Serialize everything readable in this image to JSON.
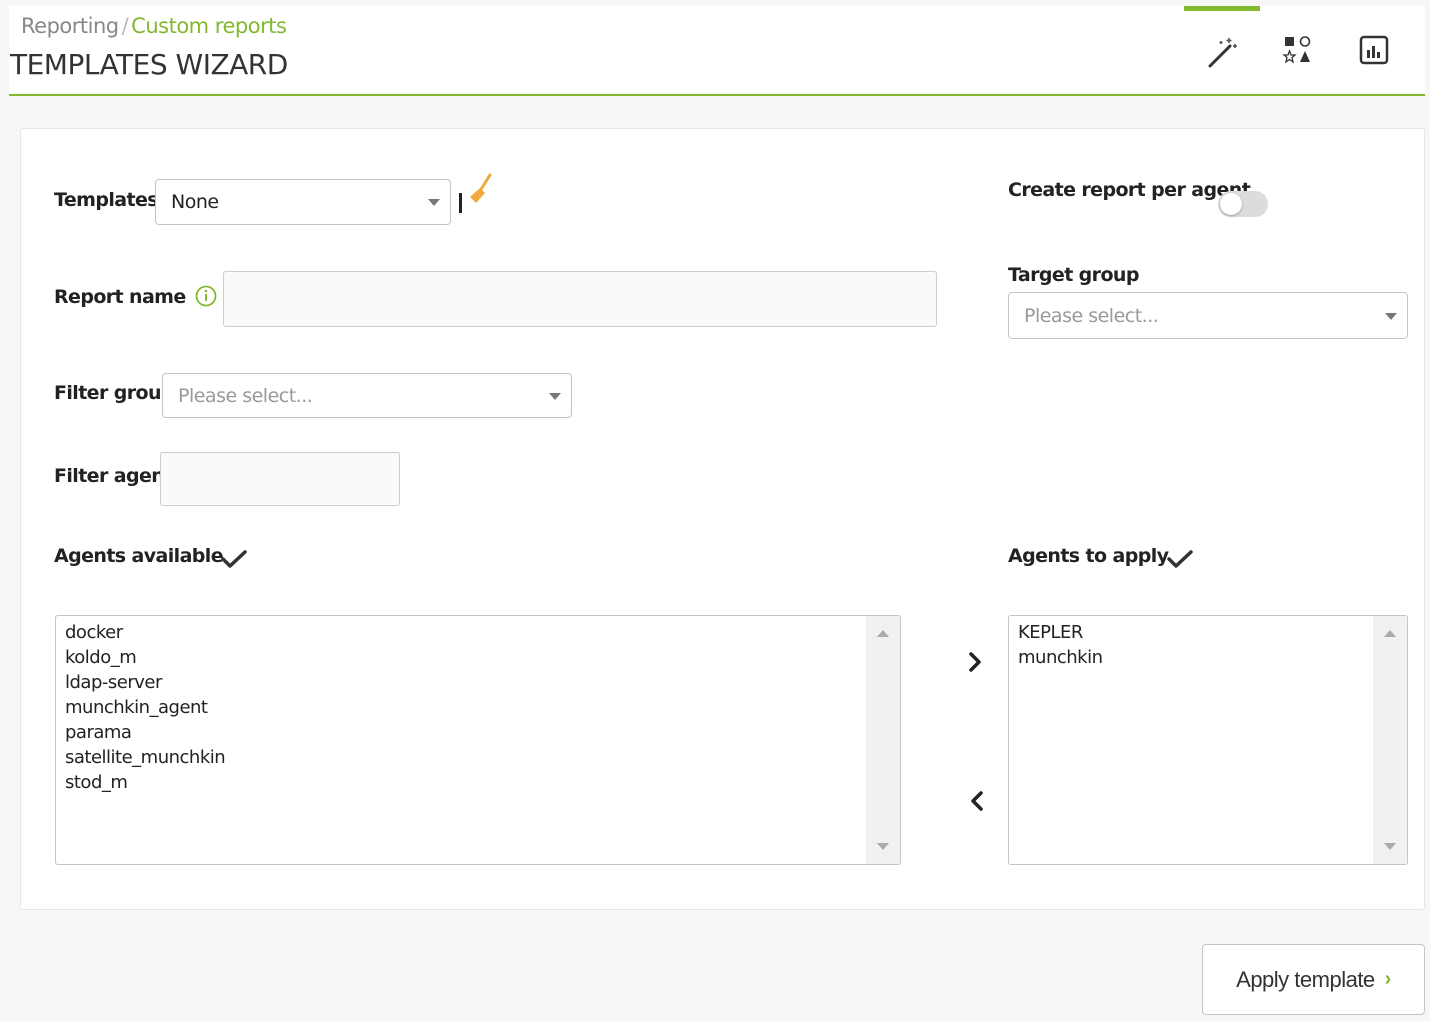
{
  "header": {
    "breadcrumb_parent": "Reporting",
    "breadcrumb_separator": "/",
    "breadcrumb_current": "Custom reports",
    "title": "TEMPLATES WIZARD",
    "tabs": [
      {
        "icon": "magic-wand-icon",
        "active": true
      },
      {
        "icon": "shapes-icon",
        "active": false
      },
      {
        "icon": "report-icon",
        "active": false
      }
    ]
  },
  "form": {
    "templates_label": "Templates",
    "templates_value": "None",
    "report_name_label": "Report name",
    "report_name_value": "",
    "filter_group_label": "Filter group",
    "filter_group_placeholder": "Please select...",
    "filter_agent_label": "Filter agent",
    "filter_agent_value": "",
    "create_per_agent_label": "Create report per agent",
    "create_per_agent_enabled": false,
    "target_group_label": "Target group",
    "target_group_placeholder": "Please select...",
    "agents_available_label": "Agents available",
    "agents_to_apply_label": "Agents to apply",
    "agents_available": [
      "docker",
      "koldo_m",
      "ldap-server",
      "munchkin_agent",
      "parama",
      "satellite_munchkin",
      "stod_m"
    ],
    "agents_to_apply": [
      "KEPLER",
      "munchkin"
    ]
  },
  "actions": {
    "apply_label": "Apply template",
    "apply_chevron": "›"
  },
  "colors": {
    "accent": "#82b92e",
    "clear_icon": "#f2a93b"
  }
}
